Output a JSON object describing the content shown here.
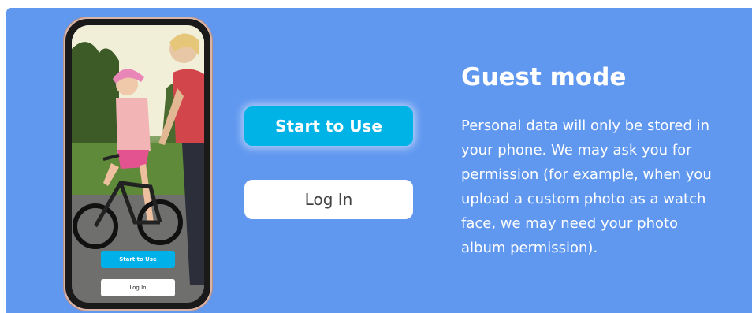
{
  "phone": {
    "image": "photo of a child riding a bicycle with an adult",
    "start_label": "Start to Use",
    "login_label": "Log In"
  },
  "actions": {
    "start_label": "Start to Use",
    "login_label": "Log In"
  },
  "info": {
    "title": "Guest mode",
    "description": "Personal data will only be stored in your phone. We may ask you for permission (for example, when you upload a custom photo as a watch face, we may need your photo album permission)."
  },
  "colors": {
    "background": "#6098f0",
    "primary_button": "#00b3e6",
    "secondary_button": "#ffffff"
  }
}
